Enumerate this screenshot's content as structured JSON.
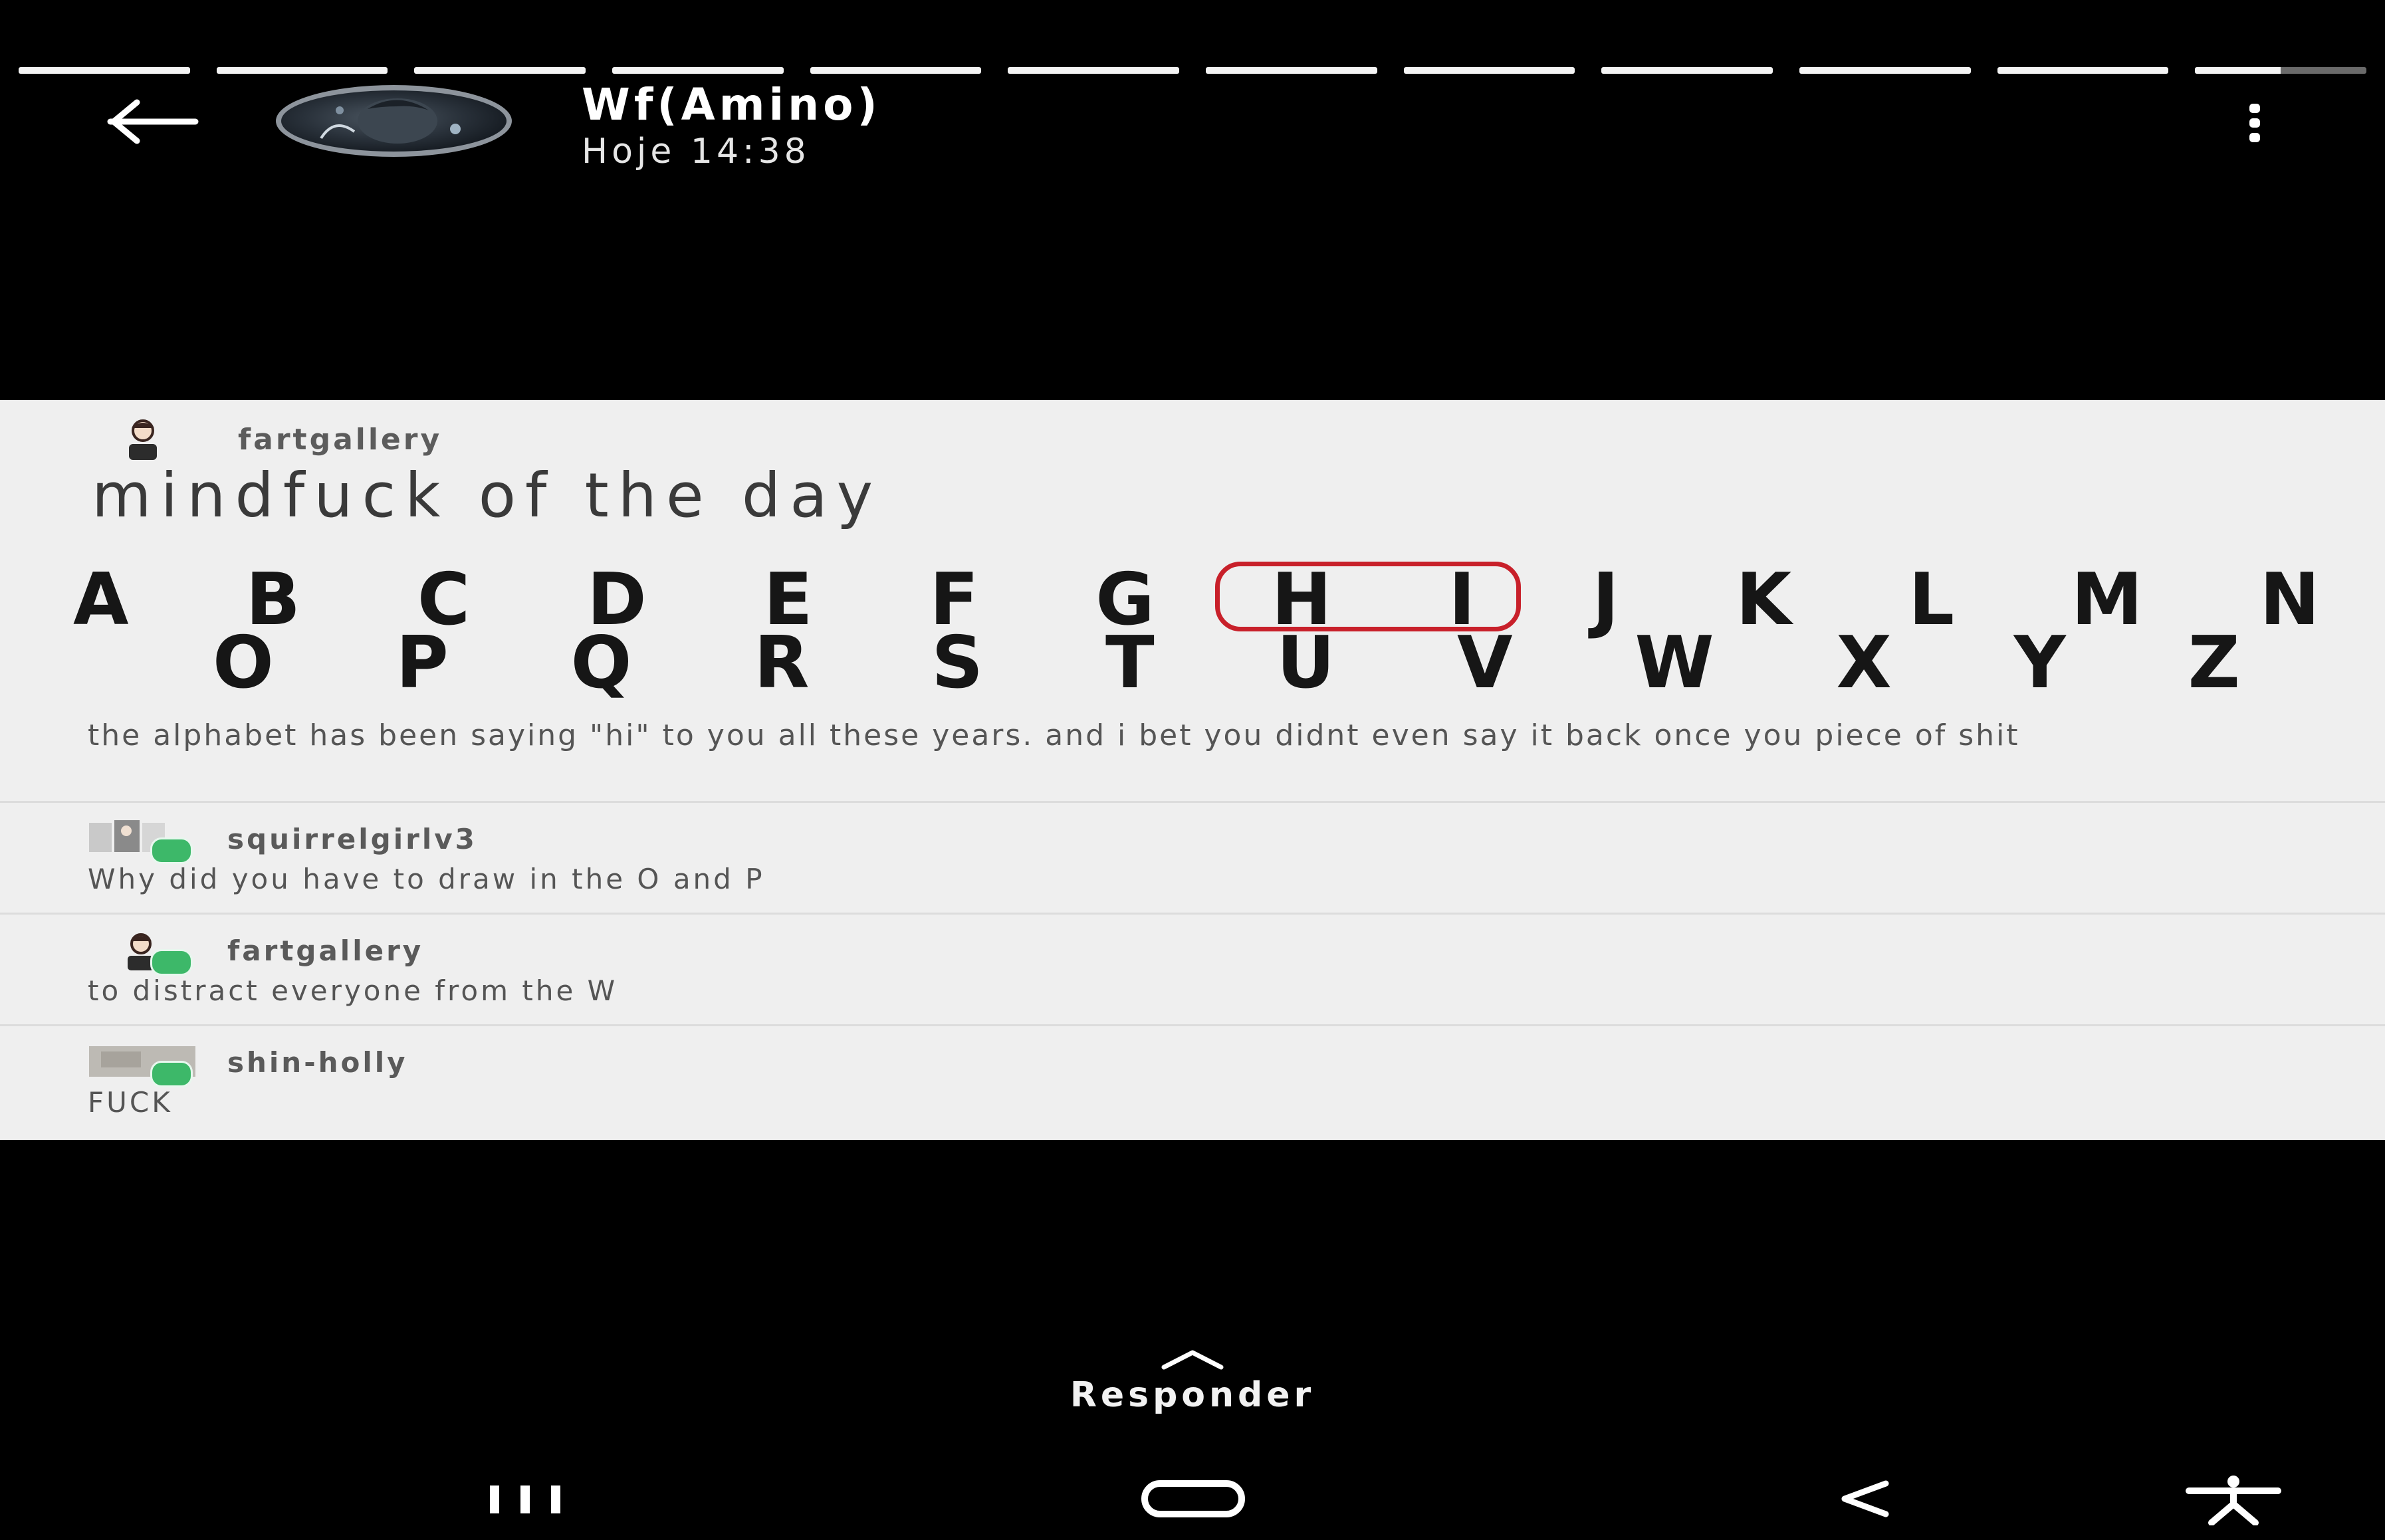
{
  "story": {
    "segments": [
      {
        "progress": 1.0
      },
      {
        "progress": 1.0
      },
      {
        "progress": 1.0
      },
      {
        "progress": 1.0
      },
      {
        "progress": 1.0
      },
      {
        "progress": 1.0
      },
      {
        "progress": 1.0
      },
      {
        "progress": 1.0
      },
      {
        "progress": 1.0
      },
      {
        "progress": 1.0
      },
      {
        "progress": 1.0
      },
      {
        "progress": 0.5
      }
    ]
  },
  "header": {
    "back_icon": "arrow-left-icon",
    "title": "Wf(Amino)",
    "subtitle": "Hoje 14:38",
    "menu_icon": "more-vertical-icon"
  },
  "post": {
    "username": "fartgallery",
    "title": "mindfuck of the day",
    "alphabet_row1": [
      "A",
      "B",
      "C",
      "D",
      "E",
      "F",
      "G",
      "H",
      "I",
      "J",
      "K",
      "L",
      "M",
      "N"
    ],
    "alphabet_row2": [
      "O",
      "P",
      "Q",
      "R",
      "S",
      "T",
      "U",
      "V",
      "W",
      "X",
      "Y",
      "Z"
    ],
    "highlight_color": "#c8202a",
    "caption": "the alphabet has been saying \"hi\" to you all these years. and i bet you didnt even say it back once you piece of shit"
  },
  "comments": [
    {
      "username": "squirrelgirlv3",
      "text": "Why did you have to draw in the O and P"
    },
    {
      "username": "fartgallery",
      "text": "to distract everyone from the W"
    },
    {
      "username": "shin-holly",
      "text": "FUCK"
    }
  ],
  "reply": {
    "label": "Responder",
    "icon": "chevron-up-icon"
  },
  "navbar": {
    "recents_icon": "recent-apps-icon",
    "home_icon": "home-icon",
    "back_icon": "back-chevron-icon",
    "accessibility_icon": "accessibility-icon"
  }
}
